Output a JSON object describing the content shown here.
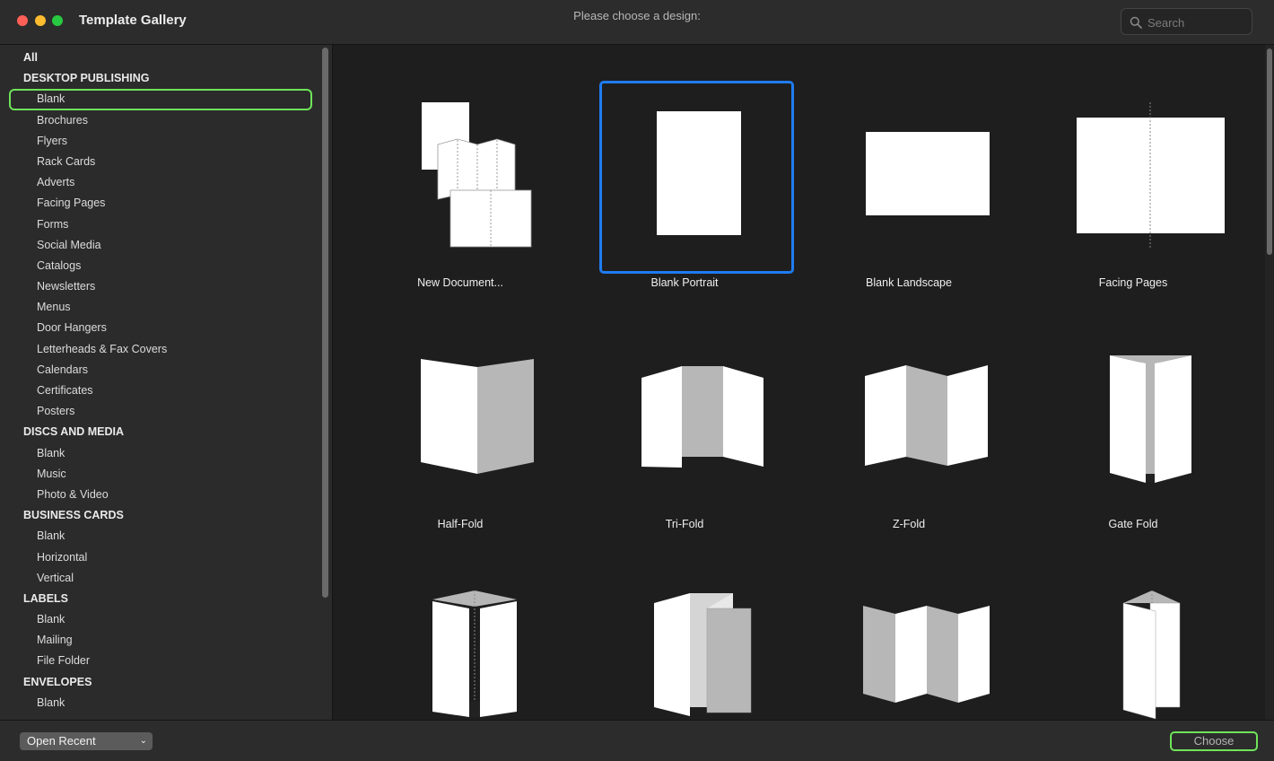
{
  "window": {
    "title": "Template Gallery",
    "prompt": "Please choose a design:"
  },
  "search": {
    "placeholder": "Search",
    "value": ""
  },
  "sidebar": {
    "rows": [
      {
        "label": "All",
        "kind": "all"
      },
      {
        "label": "DESKTOP PUBLISHING",
        "kind": "heading"
      },
      {
        "label": "Blank",
        "kind": "item",
        "selected": true
      },
      {
        "label": "Brochures",
        "kind": "item"
      },
      {
        "label": "Flyers",
        "kind": "item"
      },
      {
        "label": "Rack Cards",
        "kind": "item"
      },
      {
        "label": "Adverts",
        "kind": "item"
      },
      {
        "label": "Facing Pages",
        "kind": "item"
      },
      {
        "label": "Forms",
        "kind": "item"
      },
      {
        "label": "Social Media",
        "kind": "item"
      },
      {
        "label": "Catalogs",
        "kind": "item"
      },
      {
        "label": "Newsletters",
        "kind": "item"
      },
      {
        "label": "Menus",
        "kind": "item"
      },
      {
        "label": "Door Hangers",
        "kind": "item"
      },
      {
        "label": "Letterheads & Fax Covers",
        "kind": "item"
      },
      {
        "label": "Calendars",
        "kind": "item"
      },
      {
        "label": "Certificates",
        "kind": "item"
      },
      {
        "label": "Posters",
        "kind": "item"
      },
      {
        "label": "DISCS AND MEDIA",
        "kind": "heading"
      },
      {
        "label": "Blank",
        "kind": "item"
      },
      {
        "label": "Music",
        "kind": "item"
      },
      {
        "label": "Photo & Video",
        "kind": "item"
      },
      {
        "label": "BUSINESS CARDS",
        "kind": "heading"
      },
      {
        "label": "Blank",
        "kind": "item"
      },
      {
        "label": "Horizontal",
        "kind": "item"
      },
      {
        "label": "Vertical",
        "kind": "item"
      },
      {
        "label": "LABELS",
        "kind": "heading"
      },
      {
        "label": "Blank",
        "kind": "item"
      },
      {
        "label": "Mailing",
        "kind": "item"
      },
      {
        "label": "File Folder",
        "kind": "item"
      },
      {
        "label": "ENVELOPES",
        "kind": "heading"
      },
      {
        "label": "Blank",
        "kind": "item"
      }
    ]
  },
  "gallery": {
    "templates": [
      {
        "label": "New Document...",
        "icon": "new-document-icon"
      },
      {
        "label": "Blank Portrait",
        "icon": "blank-portrait-icon",
        "selected": true
      },
      {
        "label": "Blank Landscape",
        "icon": "blank-landscape-icon"
      },
      {
        "label": "Facing Pages",
        "icon": "facing-pages-icon"
      },
      {
        "label": "Half-Fold",
        "icon": "half-fold-icon"
      },
      {
        "label": "Tri-Fold",
        "icon": "tri-fold-icon"
      },
      {
        "label": "Z-Fold",
        "icon": "z-fold-icon"
      },
      {
        "label": "Gate Fold",
        "icon": "gate-fold-icon"
      },
      {
        "label": "",
        "icon": "double-gate-fold-icon"
      },
      {
        "label": "",
        "icon": "roll-fold-icon"
      },
      {
        "label": "",
        "icon": "accordion-fold-icon"
      },
      {
        "label": "",
        "icon": "french-fold-icon"
      }
    ]
  },
  "footer": {
    "open_recent": "Open Recent",
    "choose": "Choose"
  },
  "colors": {
    "accent_selection": "#1f7cf1",
    "focus_ring": "#6fe35a",
    "page_white": "#ffffff",
    "fold_gray": "#b7b7b7"
  }
}
